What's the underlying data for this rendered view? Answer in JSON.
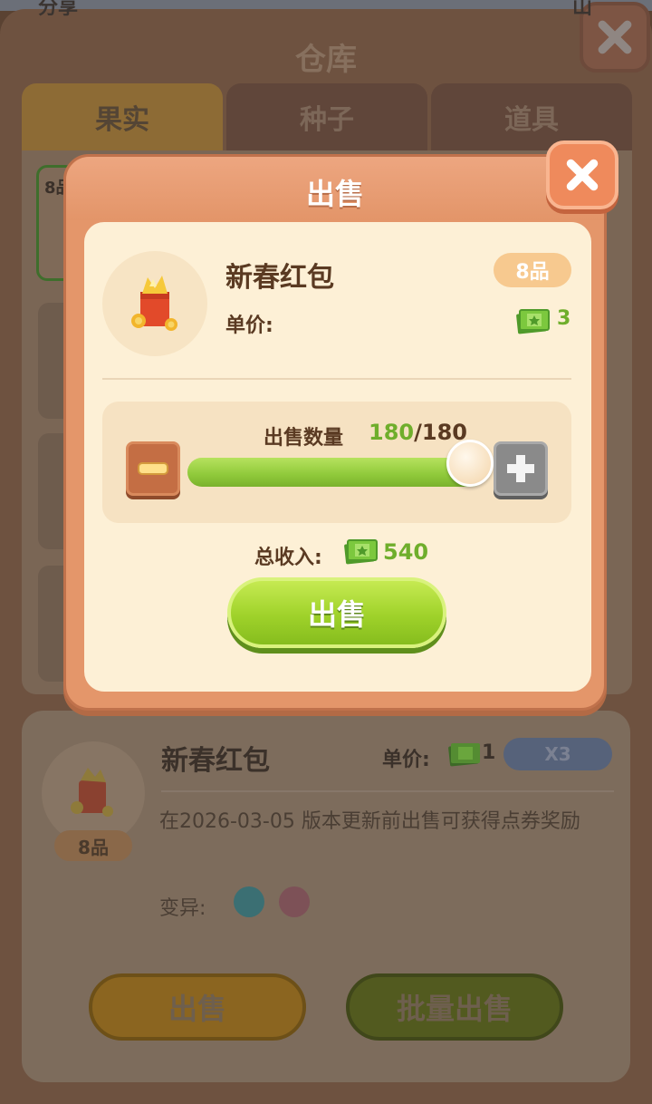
{
  "background": {
    "top_left_label": "分享",
    "top_right_label": "山",
    "title": "仓库",
    "tabs": [
      {
        "label": "果实",
        "active": true
      },
      {
        "label": "种子",
        "active": false
      },
      {
        "label": "道具",
        "active": false
      }
    ],
    "selected_cell_tag": "8品",
    "detail": {
      "name": "新春红包",
      "price_label": "单价:",
      "price_value": "1",
      "multiplier": "X3",
      "grade": "8品",
      "description": "在2026-03-05 版本更新前出售可获得点券奖励",
      "mutation_label": "变异:",
      "mutation_icons": [
        "clover-mutation-icon",
        "heart-mutation-icon"
      ],
      "sell_label": "出售",
      "batch_sell_label": "批量出售"
    }
  },
  "modal": {
    "title": "出售",
    "item": {
      "name": "新春红包",
      "grade": "8品",
      "price_label": "单价:",
      "price_value": "3",
      "icon": "red-envelope-icon"
    },
    "quantity": {
      "label": "出售数量",
      "current": "180",
      "max": "/180",
      "fill_fraction": 1.0
    },
    "income": {
      "label": "总收入:",
      "value": "540",
      "currency_icon": "cash-icon"
    },
    "sell_button_label": "出售"
  },
  "colors": {
    "accent_green": "#6fae2c",
    "modal_orange": "#e4966a",
    "modal_body": "#fdf0d6",
    "text_brown": "#5a3a22"
  }
}
